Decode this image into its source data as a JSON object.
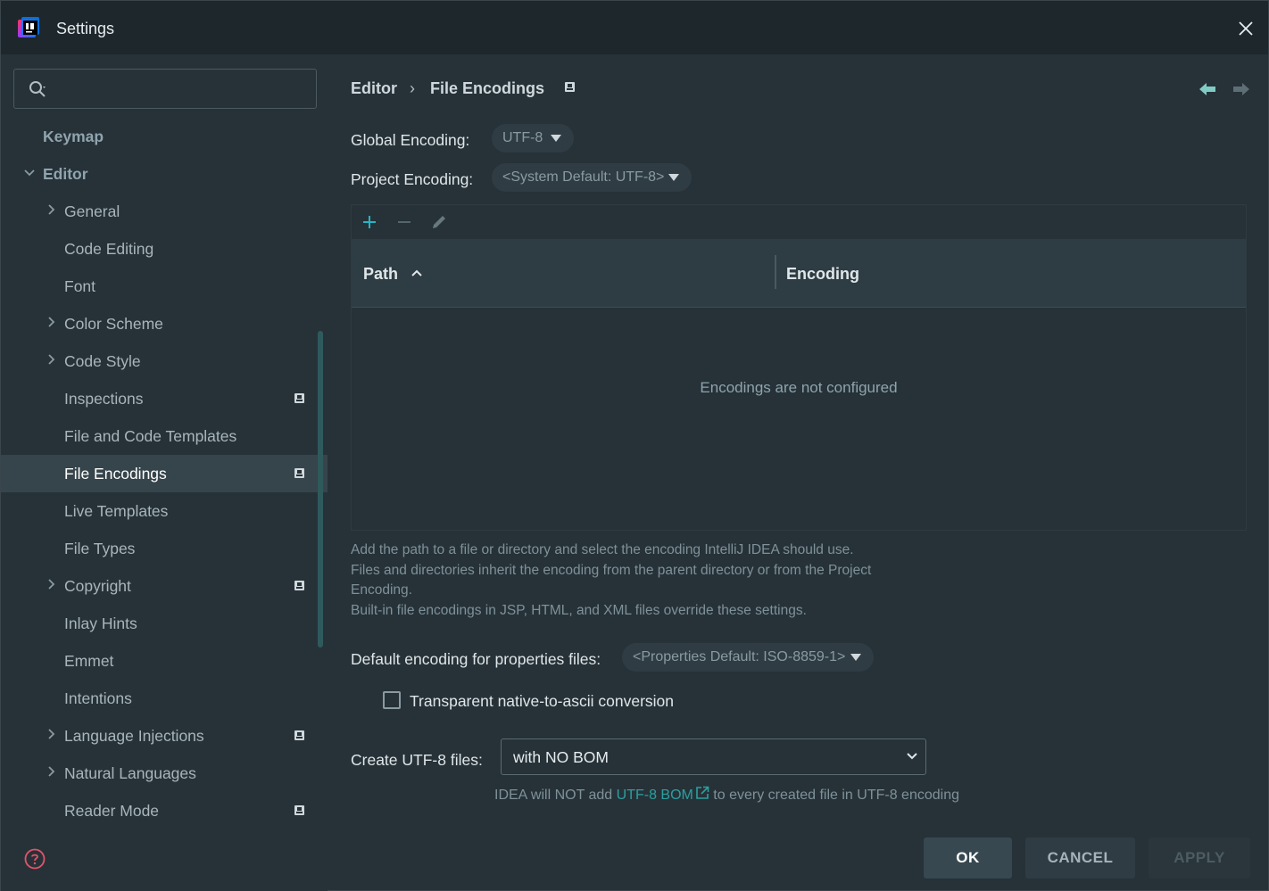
{
  "window": {
    "title": "Settings"
  },
  "search": {
    "value": "",
    "placeholder": ""
  },
  "sidebar": {
    "items": [
      {
        "label": "Keymap",
        "level": 0,
        "expandable": false,
        "badge": false,
        "selected": false
      },
      {
        "label": "Editor",
        "level": 0,
        "expandable": true,
        "expanded": true,
        "badge": false,
        "selected": false
      },
      {
        "label": "General",
        "level": 1,
        "expandable": true,
        "badge": false,
        "selected": false
      },
      {
        "label": "Code Editing",
        "level": 1,
        "expandable": false,
        "badge": false,
        "selected": false
      },
      {
        "label": "Font",
        "level": 1,
        "expandable": false,
        "badge": false,
        "selected": false
      },
      {
        "label": "Color Scheme",
        "level": 1,
        "expandable": true,
        "badge": false,
        "selected": false
      },
      {
        "label": "Code Style",
        "level": 1,
        "expandable": true,
        "badge": false,
        "selected": false
      },
      {
        "label": "Inspections",
        "level": 1,
        "expandable": false,
        "badge": true,
        "selected": false
      },
      {
        "label": "File and Code Templates",
        "level": 1,
        "expandable": false,
        "badge": false,
        "selected": false
      },
      {
        "label": "File Encodings",
        "level": 1,
        "expandable": false,
        "badge": true,
        "selected": true
      },
      {
        "label": "Live Templates",
        "level": 1,
        "expandable": false,
        "badge": false,
        "selected": false
      },
      {
        "label": "File Types",
        "level": 1,
        "expandable": false,
        "badge": false,
        "selected": false
      },
      {
        "label": "Copyright",
        "level": 1,
        "expandable": true,
        "badge": true,
        "selected": false
      },
      {
        "label": "Inlay Hints",
        "level": 1,
        "expandable": false,
        "badge": false,
        "selected": false
      },
      {
        "label": "Emmet",
        "level": 1,
        "expandable": false,
        "badge": false,
        "selected": false
      },
      {
        "label": "Intentions",
        "level": 1,
        "expandable": false,
        "badge": false,
        "selected": false
      },
      {
        "label": "Language Injections",
        "level": 1,
        "expandable": true,
        "badge": true,
        "selected": false
      },
      {
        "label": "Natural Languages",
        "level": 1,
        "expandable": true,
        "badge": false,
        "selected": false
      },
      {
        "label": "Reader Mode",
        "level": 1,
        "expandable": false,
        "badge": true,
        "selected": false
      }
    ]
  },
  "breadcrumb": {
    "parent": "Editor",
    "separator": "›",
    "current": "File Encodings"
  },
  "global_encoding": {
    "label": "Global Encoding:",
    "value": "UTF-8"
  },
  "project_encoding": {
    "label": "Project Encoding:",
    "value": "<System Default: UTF-8>"
  },
  "table": {
    "columns": [
      "Path",
      "Encoding"
    ],
    "sorted_column": "Path",
    "sort_direction": "ascending",
    "rows": [],
    "empty_text": "Encodings are not configured"
  },
  "help": {
    "lines": [
      "Add the path to a file or directory and select the encoding IntelliJ IDEA should use.",
      "Files and directories inherit the encoding from the parent directory or from the Project",
      "Encoding.",
      "Built-in file encodings in JSP, HTML, and XML files override these settings."
    ]
  },
  "properties_encoding": {
    "label": "Default encoding for properties files:",
    "value": "<Properties Default: ISO-8859-1>"
  },
  "native_to_ascii": {
    "label": "Transparent native-to-ascii conversion",
    "checked": false
  },
  "create_utf8": {
    "label": "Create UTF-8 files:",
    "value": "with NO BOM",
    "note_before": "IDEA will NOT add ",
    "note_link": "UTF-8 BOM",
    "note_after": " to every created file in UTF-8 encoding"
  },
  "buttons": {
    "ok": "OK",
    "cancel": "CANCEL",
    "apply": "APPLY"
  },
  "colors": {
    "background": "#263238",
    "accent": "#2ba0a0",
    "selected_row": "#36444b"
  }
}
